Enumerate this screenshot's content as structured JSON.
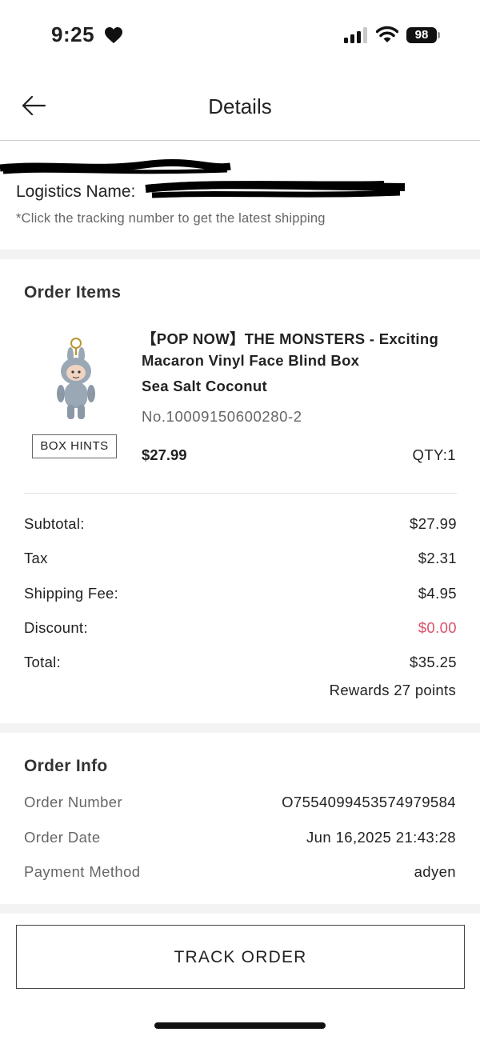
{
  "status_bar": {
    "time": "9:25",
    "battery": "98",
    "icons": [
      "heart-icon",
      "signal-icon",
      "wifi-icon",
      "battery-icon"
    ]
  },
  "header": {
    "title": "Details",
    "back_icon": "back-arrow-icon"
  },
  "logistics": {
    "label": "Logistics Name:",
    "note": "*Click the tracking number to get the latest shipping"
  },
  "order_items": {
    "title": "Order Items",
    "box_hints_label": "BOX HINTS",
    "product": {
      "name": "【POP NOW】THE MONSTERS - Exciting Macaron Vinyl Face Blind Box",
      "variant": "Sea Salt Coconut",
      "sku": "No.10009150600280-2",
      "price": "$27.99",
      "qty": "QTY:1"
    },
    "summary": [
      {
        "label": "Subtotal:",
        "value": "$27.99"
      },
      {
        "label": "Tax",
        "value": "$2.31"
      },
      {
        "label": "Shipping Fee:",
        "value": "$4.95"
      },
      {
        "label": "Discount:",
        "value": "$0.00"
      },
      {
        "label": "Total:",
        "value": "$35.25"
      }
    ],
    "rewards": "Rewards 27 points"
  },
  "order_info": {
    "title": "Order Info",
    "rows": [
      {
        "label": "Order Number",
        "value": "O7554099453574979584"
      },
      {
        "label": "Order Date",
        "value": "Jun 16,2025 21:43:28"
      },
      {
        "label": "Payment Method",
        "value": "adyen"
      }
    ]
  },
  "track_button_label": "TRACK ORDER",
  "colors": {
    "discount": "#d9536b",
    "section_gap": "#f3f3f3",
    "muted_text": "#666666"
  }
}
